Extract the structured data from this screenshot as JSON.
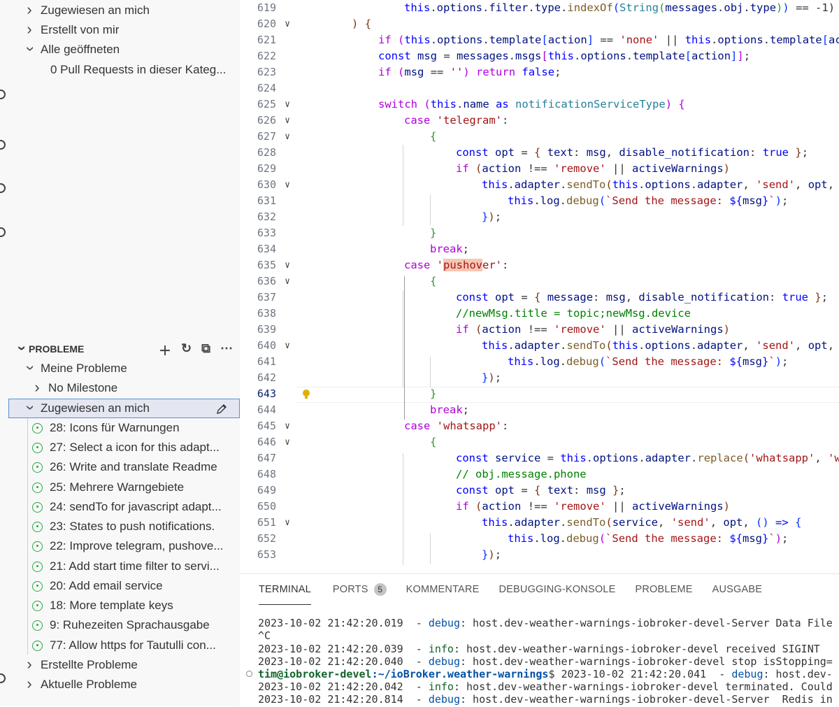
{
  "sidebar": {
    "top_items": [
      {
        "label": "Zugewiesen an mich",
        "chevron": "right"
      },
      {
        "label": "Erstellt von mir",
        "chevron": "right"
      },
      {
        "label": "Alle geöffneten",
        "chevron": "down"
      },
      {
        "label": "0 Pull Requests in dieser Kateg...",
        "chevron": "none"
      }
    ],
    "problems_header": "PROBLEME",
    "problems_actions": [
      "plus-icon",
      "refresh-icon",
      "collapse-icon",
      "more-icon"
    ],
    "problems_items": [
      {
        "label": "Meine Probleme",
        "chevron": "down"
      },
      {
        "label": "No Milestone",
        "chevron": "right"
      },
      {
        "label": "Zugewiesen an mich",
        "chevron": "down",
        "selected": true
      }
    ],
    "issues": [
      "28: Icons für Warnungen",
      "27: Select a icon for this adapt...",
      "26: Write and translate Readme",
      "25: Mehrere Warngebiete",
      "24: sendTo for javascript adapt...",
      "23: States to push notifications.",
      "22: Improve telegram, pushove...",
      "21: Add start time filter to servi...",
      "20: Add email service",
      "18: More template keys",
      "9: Ruhezeiten Sprachausgabe",
      "77: Allow https for Tautulli con..."
    ],
    "bottom_items": [
      {
        "label": "Erstellte Probleme",
        "chevron": "right"
      },
      {
        "label": "Aktuelle Probleme",
        "chevron": "right"
      }
    ]
  },
  "editor": {
    "active_line": 643,
    "lines": [
      {
        "n": 619,
        "fold": false
      },
      {
        "n": 620,
        "fold": true
      },
      {
        "n": 621,
        "fold": false
      },
      {
        "n": 622,
        "fold": false
      },
      {
        "n": 623,
        "fold": false
      },
      {
        "n": 624,
        "fold": false
      },
      {
        "n": 625,
        "fold": true
      },
      {
        "n": 626,
        "fold": true
      },
      {
        "n": 627,
        "fold": true
      },
      {
        "n": 628,
        "fold": false
      },
      {
        "n": 629,
        "fold": false
      },
      {
        "n": 630,
        "fold": true
      },
      {
        "n": 631,
        "fold": false
      },
      {
        "n": 632,
        "fold": false
      },
      {
        "n": 633,
        "fold": false
      },
      {
        "n": 634,
        "fold": false
      },
      {
        "n": 635,
        "fold": true
      },
      {
        "n": 636,
        "fold": true
      },
      {
        "n": 637,
        "fold": false
      },
      {
        "n": 638,
        "fold": false
      },
      {
        "n": 639,
        "fold": false
      },
      {
        "n": 640,
        "fold": true
      },
      {
        "n": 641,
        "fold": false
      },
      {
        "n": 642,
        "fold": false
      },
      {
        "n": 643,
        "fold": false
      },
      {
        "n": 644,
        "fold": false
      },
      {
        "n": 645,
        "fold": true
      },
      {
        "n": 646,
        "fold": true
      },
      {
        "n": 647,
        "fold": false
      },
      {
        "n": 648,
        "fold": false
      },
      {
        "n": 649,
        "fold": false
      },
      {
        "n": 650,
        "fold": false
      },
      {
        "n": 651,
        "fold": true
      },
      {
        "n": 652,
        "fold": false
      },
      {
        "n": 653,
        "fold": false
      }
    ]
  },
  "panel": {
    "tabs": [
      {
        "label": "TERMINAL",
        "active": true
      },
      {
        "label": "PORTS",
        "badge": "5"
      },
      {
        "label": "KOMMENTARE"
      },
      {
        "label": "DEBUGGING-KONSOLE"
      },
      {
        "label": "PROBLEME"
      },
      {
        "label": "AUSGABE"
      }
    ],
    "terminal": {
      "l1_time": "2023-10-02 21:42:20.019",
      "l1_level": "debug",
      "l1_msg": ": host.dev-weather-warnings-iobroker-devel-Server Data File",
      "l2": "^C",
      "l3_time": "2023-10-02 21:42:20.039",
      "l3_level": "info",
      "l3_msg": ": host.dev-weather-warnings-iobroker-devel received SIGINT",
      "l4_time": "2023-10-02 21:42:20.040",
      "l4_level": "debug",
      "l4_msg": ": host.dev-weather-warnings-iobroker-devel stop isStopping=",
      "l5_user": "tim@iobroker-devel",
      "l5_path": ":~/ioBroker.weather-warnings",
      "l5_rest": "$ 2023-10-02 21:42:20.041",
      "l5_level": "debug",
      "l5_msg": ": host.dev-",
      "l6_time": "2023-10-02 21:42:20.042",
      "l6_level": "info",
      "l6_msg": ": host.dev-weather-warnings-iobroker-devel terminated. Could",
      "l7_time": "2023-10-02 21:42:20.814",
      "l7_level": "debug",
      "l7_msg": ": host.dev-weather-warnings-iobroker-devel-Server  Redis in"
    }
  }
}
